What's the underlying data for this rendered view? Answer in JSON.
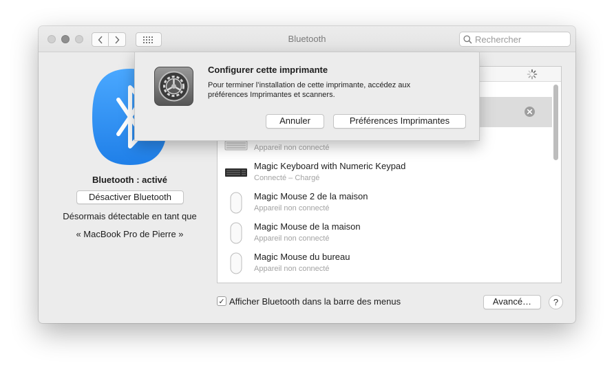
{
  "window": {
    "title": "Bluetooth"
  },
  "search": {
    "placeholder": "Rechercher"
  },
  "left_pane": {
    "status": "Bluetooth : activé",
    "toggle_button": "Désactiver Bluetooth",
    "discoverable_line1": "Désormais détectable en tant que",
    "discoverable_line2": "« MacBook Pro de Pierre »"
  },
  "devices": [
    {
      "name": "Magic Keyboard with Numeric Keypad",
      "status": "Connecté – Chargé",
      "icon": "keyboard-dark-icon"
    },
    {
      "name": "Magic Mouse 2 de la maison",
      "status": "Appareil non connecté",
      "icon": "mouse-icon"
    },
    {
      "name": "Magic Mouse de la maison",
      "status": "Appareil non connecté",
      "icon": "mouse-icon"
    },
    {
      "name": "Magic Mouse du bureau",
      "status": "Appareil non connecté",
      "icon": "mouse-icon"
    }
  ],
  "partial_row": {
    "status": "Appareil non connecté",
    "icon": "keyboard-light-icon"
  },
  "footer": {
    "show_in_menu_label": "Afficher Bluetooth dans la barre des menus",
    "show_in_menu_checked": true,
    "advanced_button": "Avancé…",
    "help_button": "?"
  },
  "dialog": {
    "title": "Configurer cette imprimante",
    "message": "Pour terminer l’installation de cette imprimante, accédez aux préférences Imprimantes et scanners.",
    "cancel_button": "Annuler",
    "confirm_button": "Préférences Imprimantes",
    "icon": "system-preferences-gear-icon"
  },
  "colors": {
    "bluetooth_blue": "#2f8ff5",
    "window_bg": "#ececec",
    "selection": "#dcdcdc"
  }
}
